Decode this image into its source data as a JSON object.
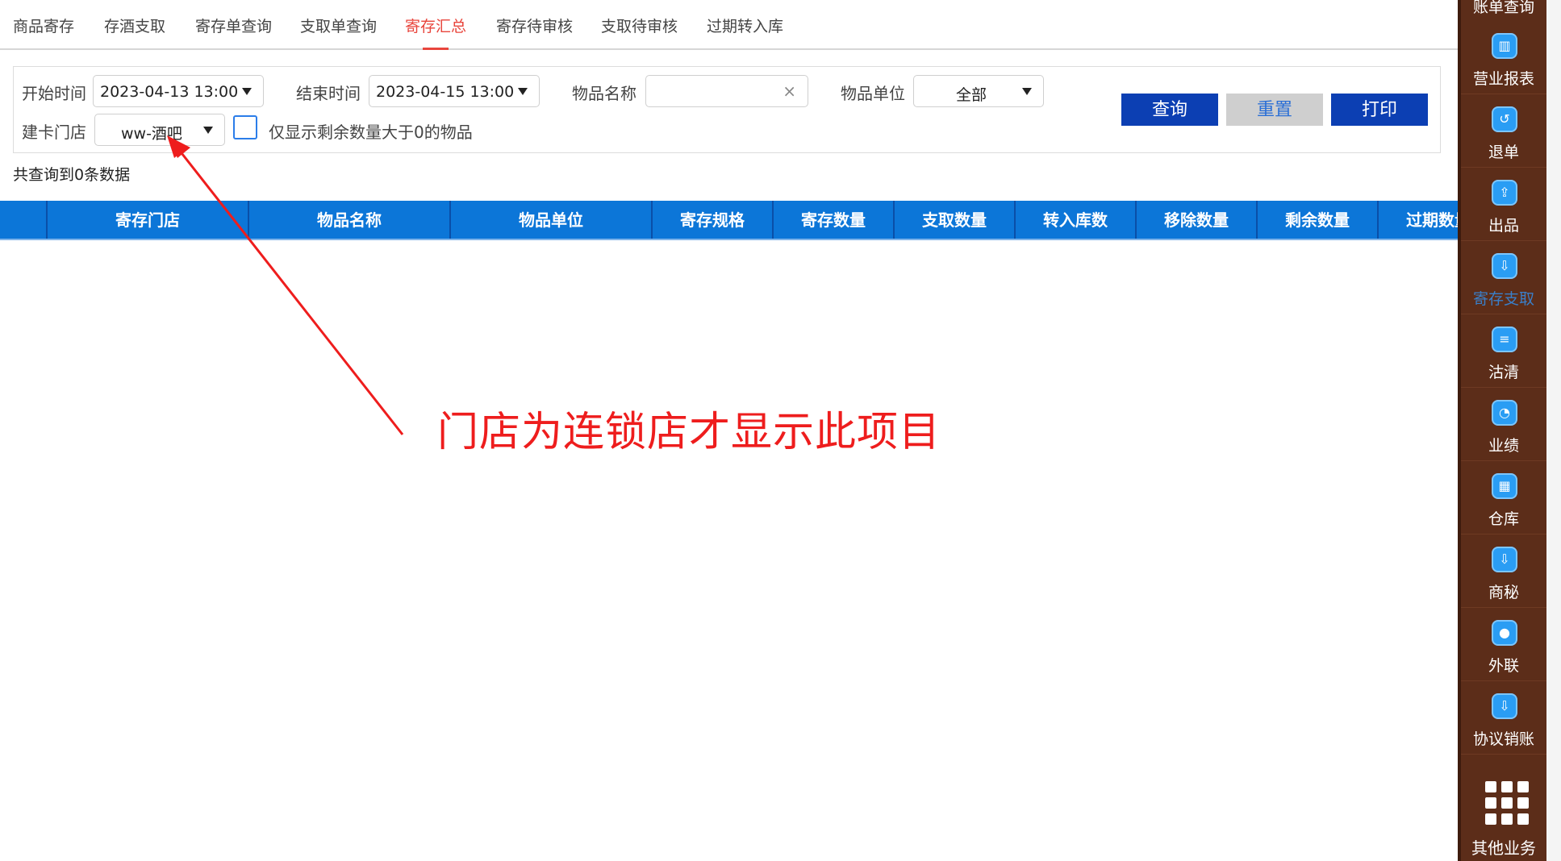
{
  "tabs": [
    {
      "label": "商品寄存",
      "active": false
    },
    {
      "label": "存酒支取",
      "active": false
    },
    {
      "label": "寄存单查询",
      "active": false
    },
    {
      "label": "支取单查询",
      "active": false
    },
    {
      "label": "寄存汇总",
      "active": true
    },
    {
      "label": "寄存待审核",
      "active": false
    },
    {
      "label": "支取待审核",
      "active": false
    },
    {
      "label": "过期转入库",
      "active": false
    }
  ],
  "filters": {
    "start_label": "开始时间",
    "start_value": "2023-04-13 13:00",
    "end_label": "结束时间",
    "end_value": "2023-04-15 13:00",
    "name_label": "物品名称",
    "name_value": "",
    "clear_symbol": "×",
    "unit_label": "物品单位",
    "unit_value": "全部",
    "store_label": "建卡门店",
    "store_value": "ww-酒吧",
    "only_positive_label": "仅显示剩余数量大于0的物品",
    "only_positive_checked": false
  },
  "buttons": {
    "query": "查询",
    "reset": "重置",
    "print": "打印"
  },
  "result_count": "共查询到0条数据",
  "table": {
    "columns": [
      "寄存门店",
      "物品名称",
      "物品单位",
      "寄存规格",
      "寄存数量",
      "支取数量",
      "转入库数",
      "移除数量",
      "剩余数量",
      "过期数量"
    ],
    "rows": []
  },
  "annotation": {
    "text": "门店为连锁店才显示此项目",
    "color": "#ee1d1d"
  },
  "sidebar": {
    "top_partial": "账单查询",
    "items": [
      {
        "label": "营业报表",
        "icon": "report-chart-icon",
        "glyph": "▥",
        "dim": false
      },
      {
        "label": "退单",
        "icon": "refund-icon",
        "glyph": "↺",
        "dim": false
      },
      {
        "label": "出品",
        "icon": "export-icon",
        "glyph": "⇪",
        "dim": false
      },
      {
        "label": "寄存支取",
        "icon": "download-icon",
        "glyph": "⇩",
        "dim": true
      },
      {
        "label": "沽清",
        "icon": "sort-list-icon",
        "glyph": "≡",
        "dim": false
      },
      {
        "label": "业绩",
        "icon": "pie-chart-icon",
        "glyph": "◔",
        "dim": false
      },
      {
        "label": "仓库",
        "icon": "grid-icon",
        "glyph": "▦",
        "dim": false
      },
      {
        "label": "商秘",
        "icon": "download-icon",
        "glyph": "⇩",
        "dim": false
      },
      {
        "label": "外联",
        "icon": "contact-icon",
        "glyph": "●",
        "dim": false
      },
      {
        "label": "协议销账",
        "icon": "download-icon",
        "glyph": "⇩",
        "dim": false
      }
    ],
    "more_label": "其他业务"
  },
  "colors": {
    "accent_red": "#e8453c",
    "header_blue": "#0c76d8",
    "button_blue": "#0c3fb3",
    "sidebar_brown": "#5c2d19"
  }
}
